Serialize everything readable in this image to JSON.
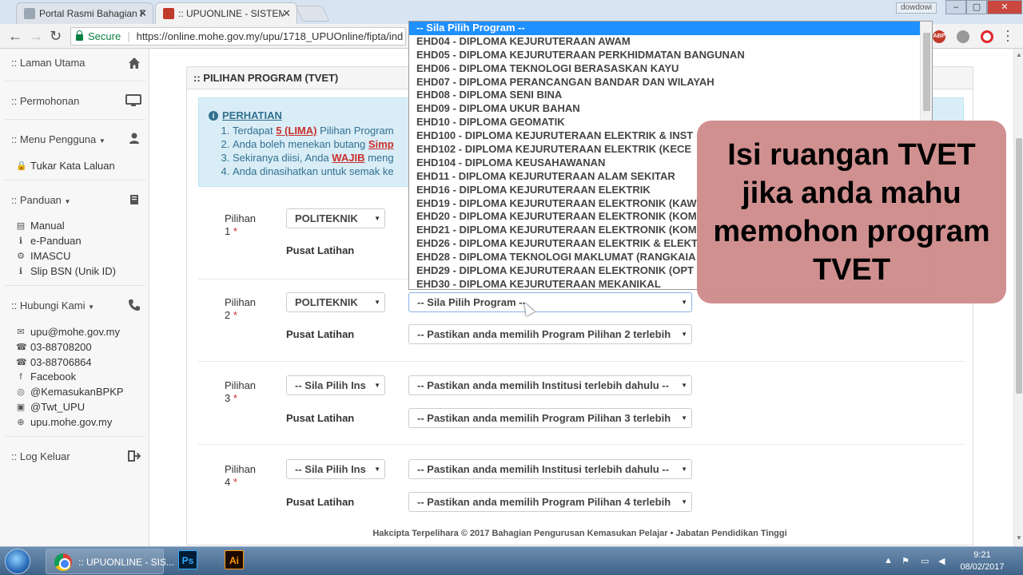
{
  "browser": {
    "tabs": [
      {
        "title": "Portal Rasmi Bahagian P...",
        "active": false
      },
      {
        "title": ":: UPUONLINE - SISTEM P...",
        "active": true
      }
    ],
    "user_chip": "dowdowi",
    "address": {
      "secure_label": "Secure",
      "url": "https://online.mohe.gov.my/upu/1718_UPUOnline/fipta/ind"
    },
    "extensions": [
      "ABP"
    ]
  },
  "sidebar": {
    "home": "Laman Utama",
    "application": "Permohonan",
    "user_menu": "Menu Pengguna",
    "user_menu_items": [
      "Tukar Kata Laluan"
    ],
    "guide": "Panduan",
    "guide_items": [
      "Manual",
      "e-Panduan",
      "IMASCU",
      "Slip BSN (Unik ID)"
    ],
    "contact": "Hubungi Kami",
    "contact_items": [
      "upu@mohe.gov.my",
      "03-88708200",
      "03-88706864",
      "Facebook",
      "@KemasukanBPKP",
      "@Twt_UPU",
      "upu.mohe.gov.my"
    ],
    "logout": "Log Keluar",
    "prefix": "::"
  },
  "main": {
    "heading": ":: PILIHAN PROGRAM (TVET)",
    "notice": {
      "title": "PERHATIAN",
      "items": [
        {
          "pre": "Terdapat ",
          "em": "5 (LIMA)",
          "post": " Pilihan Program"
        },
        {
          "pre": "Anda boleh menekan butang ",
          "em": "Simp",
          "post": ""
        },
        {
          "pre": "Sekiranya diisi, Anda ",
          "em": "WAJIB",
          "post": " meng"
        },
        {
          "pre": "Anda dinasihatkan untuk semak ke",
          "em": "",
          "post": ""
        }
      ]
    },
    "choice_label": "Pilihan",
    "required_mark": "*",
    "centre_label": "Pusat Latihan",
    "choices": [
      {
        "number": "1",
        "institution": "POLITEKNIK",
        "program": "",
        "centre": ""
      },
      {
        "number": "2",
        "institution": "POLITEKNIK",
        "program": "-- Sila Pilih Program --",
        "centre": "-- Pastikan anda memilih Program Pilihan 2 terlebih"
      },
      {
        "number": "3",
        "institution": "-- Sila Pilih Ins",
        "program": "-- Pastikan anda memilih Institusi terlebih dahulu --",
        "centre": "-- Pastikan anda memilih Program Pilihan 3 terlebih"
      },
      {
        "number": "4",
        "institution": "-- Sila Pilih Ins",
        "program": "-- Pastikan anda memilih Institusi terlebih dahulu --",
        "centre": "-- Pastikan anda memilih Program Pilihan 4 terlebih"
      }
    ],
    "footer": "Hakcipta Terpelihara © 2017 Bahagian Pengurusan Kemasukan Pelajar • Jabatan Pendidikan Tinggi"
  },
  "dropdown": {
    "options": [
      "-- Sila Pilih Program --",
      "EHD04 - DIPLOMA KEJURUTERAAN AWAM",
      "EHD05 - DIPLOMA KEJURUTERAAN PERKHIDMATAN BANGUNAN",
      "EHD06 - DIPLOMA TEKNOLOGI BERASASKAN KAYU",
      "EHD07 - DIPLOMA PERANCANGAN BANDAR DAN WILAYAH",
      "EHD08 - DIPLOMA SENI BINA",
      "EHD09 - DIPLOMA UKUR BAHAN",
      "EHD10 - DIPLOMA GEOMATIK",
      "EHD100 - DIPLOMA KEJURUTERAAN ELEKTRIK & INST",
      "EHD102 - DIPLOMA KEJURUTERAAN ELEKTRIK (KECE",
      "EHD104 - DIPLOMA KEUSAHAWANAN",
      "EHD11 - DIPLOMA KEJURUTERAAN ALAM SEKITAR",
      "EHD16 - DIPLOMA KEJURUTERAAN ELEKTRIK",
      "EHD19 - DIPLOMA KEJURUTERAAN ELEKTRONIK (KAW",
      "EHD20 - DIPLOMA KEJURUTERAAN ELEKTRONIK (KOM",
      "EHD21 - DIPLOMA KEJURUTERAAN ELEKTRONIK (KOM",
      "EHD26 - DIPLOMA KEJURUTERAAN ELEKTRIK & ELEKT",
      "EHD28 - DIPLOMA TEKNOLOGI MAKLUMAT (RANGKAIA",
      "EHD29 - DIPLOMA KEJURUTERAAN ELEKTRONIK (OPT",
      "EHD30 - DIPLOMA KEJURUTERAAN MEKANIKAL"
    ],
    "highlighted_index": 0
  },
  "overlay": {
    "lines": [
      "Isi ruangan TVET",
      "jika anda mahu",
      "memohon program",
      "TVET"
    ]
  },
  "taskbar": {
    "chrome_label": ":: UPUONLINE - SIS...",
    "apps": [
      "Ps",
      "Ai"
    ],
    "time": "9:21",
    "date": "08/02/2017"
  },
  "colors": {
    "accent": "#1e90ff",
    "required": "#c9302c",
    "notice_bg": "#d9edf7",
    "overlay_bg": "#d08c8c"
  }
}
